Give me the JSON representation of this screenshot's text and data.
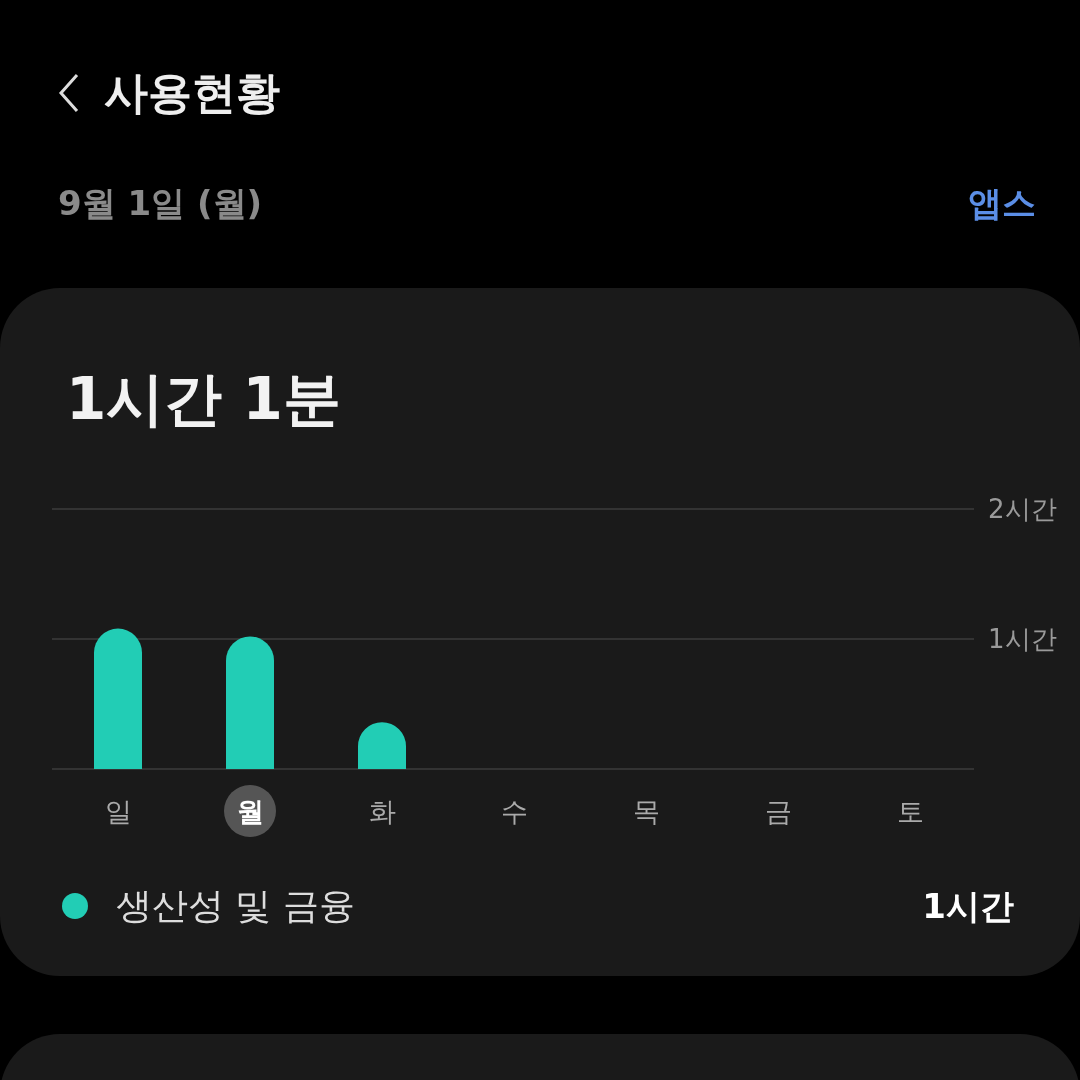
{
  "header": {
    "title": "사용현황",
    "date": "9월 1일 (월)",
    "link": "앱스"
  },
  "usage_card": {
    "total": "1시간 1분",
    "chart_data": {
      "type": "bar",
      "categories": [
        "일",
        "월",
        "화",
        "수",
        "목",
        "금",
        "토"
      ],
      "values": [
        1.08,
        1.02,
        0.36,
        null,
        null,
        null,
        null
      ],
      "ylim": [
        0,
        2
      ],
      "yticks": [
        {
          "value": 1,
          "label": "1시간"
        },
        {
          "value": 2,
          "label": "2시간"
        }
      ]
    },
    "day_selected": [
      false,
      true,
      false,
      false,
      false,
      false,
      false
    ],
    "legend": [
      {
        "label": "생산성 및 금융",
        "value": "1시간",
        "color": "#22cdb5"
      }
    ]
  },
  "next_card": {
    "kind": "card"
  }
}
